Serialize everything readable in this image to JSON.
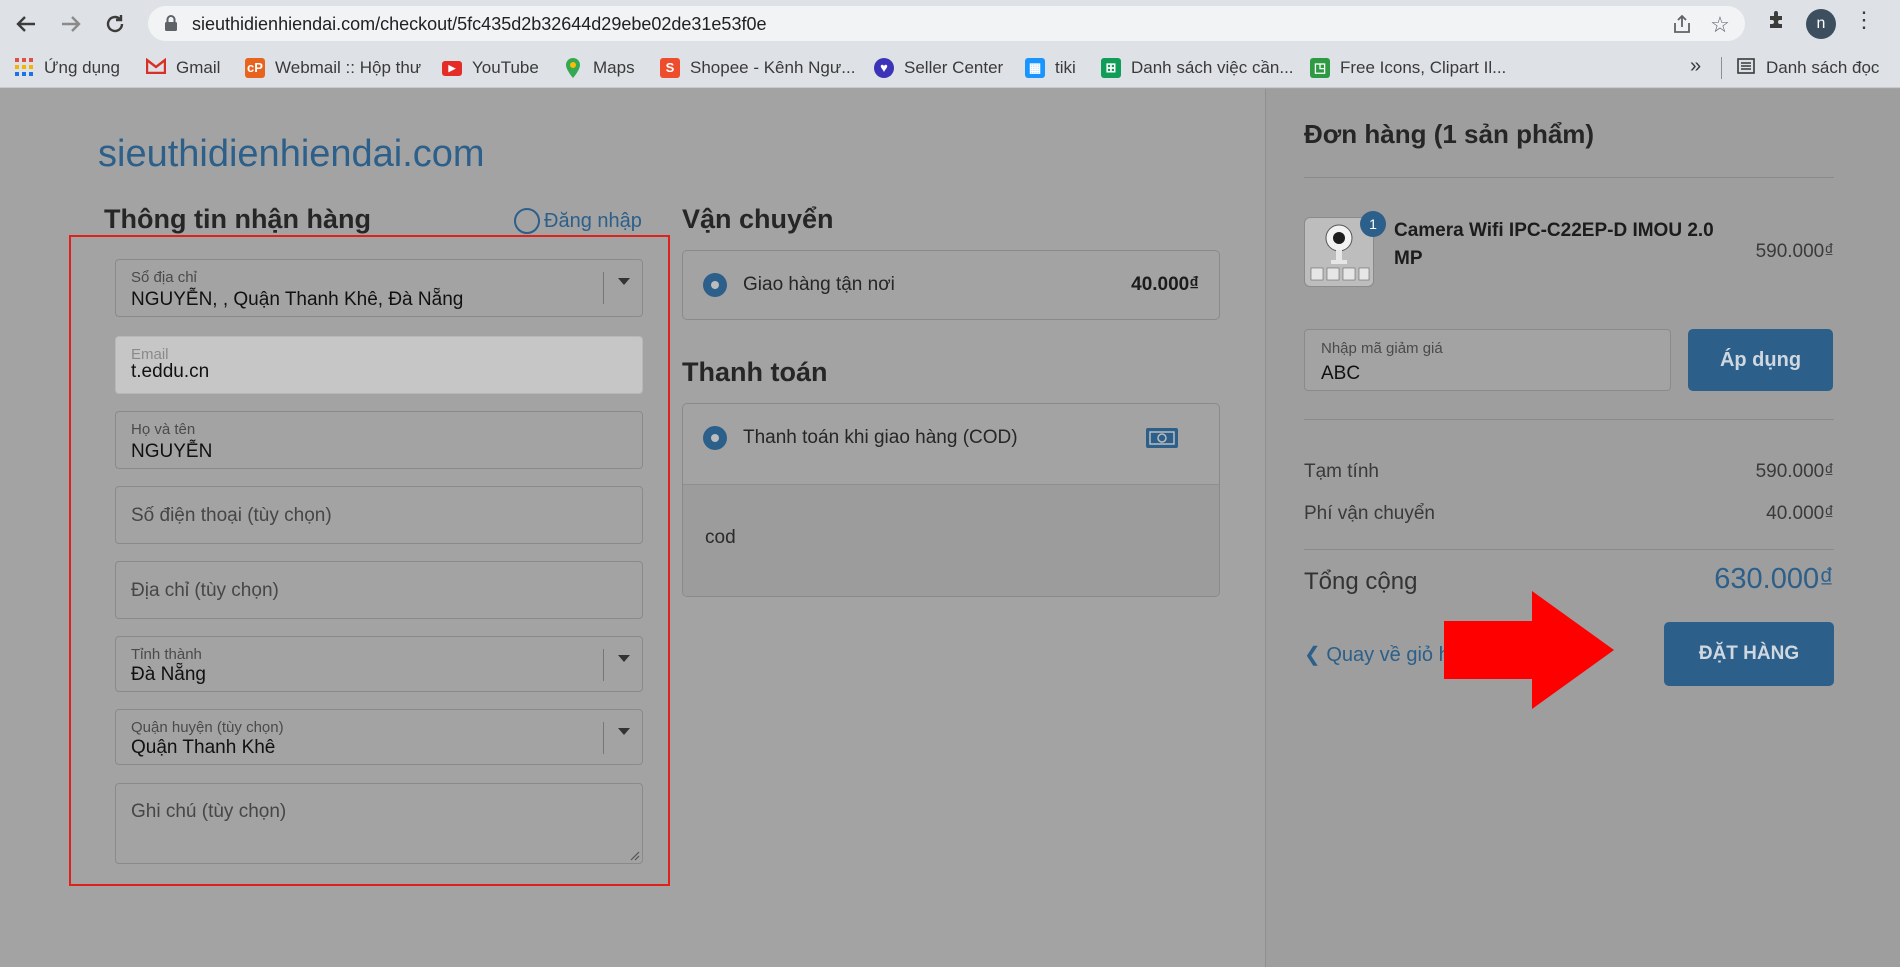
{
  "browser": {
    "url": "sieuthidienhiendai.com/checkout/5fc435d2b32644d29ebe02de31e53f0e",
    "profile_initial": "n"
  },
  "bookmarks": [
    {
      "label": "Ứng dụng",
      "icon": "apps-grid-icon"
    },
    {
      "label": "Gmail",
      "icon": "gmail-icon"
    },
    {
      "label": "Webmail :: Hộp thư",
      "icon": "webmail-icon"
    },
    {
      "label": "YouTube",
      "icon": "youtube-icon"
    },
    {
      "label": "Maps",
      "icon": "maps-icon"
    },
    {
      "label": "Shopee - Kênh Ngư...",
      "icon": "shopee-icon"
    },
    {
      "label": "Seller Center",
      "icon": "seller-center-icon"
    },
    {
      "label": "tiki",
      "icon": "tiki-icon"
    },
    {
      "label": "Danh sách việc cần...",
      "icon": "sheets-icon"
    },
    {
      "label": "Free Icons, Clipart Il...",
      "icon": "freeicons-icon"
    }
  ],
  "bookmarks_more": "»",
  "reading_list": "Danh sách đọc",
  "site": {
    "title": "sieuthidienhiendai.com"
  },
  "shipping_info": {
    "heading": "Thông tin nhận hàng",
    "login_label": "Đăng nhập",
    "address_book": {
      "label": "Sổ địa chỉ",
      "value": "NGUYỄN, , Quận Thanh Khê, Đà Nẵng"
    },
    "email": {
      "label": "Email",
      "value": "t.eddu.cn"
    },
    "fullname": {
      "label": "Họ và tên",
      "value": "NGUYỄN"
    },
    "phone": {
      "placeholder": "Số điện thoại (tùy chọn)"
    },
    "address": {
      "placeholder": "Địa chỉ (tùy chọn)"
    },
    "province": {
      "label": "Tỉnh thành",
      "value": "Đà Nẵng"
    },
    "district": {
      "label": "Quận huyện (tùy chọn)",
      "value": "Quận Thanh Khê"
    },
    "note": {
      "placeholder": "Ghi chú (tùy chọn)"
    }
  },
  "shipping": {
    "heading": "Vận chuyển",
    "option": "Giao hàng tận nơi",
    "price": "40.000₫"
  },
  "payment": {
    "heading": "Thanh toán",
    "option": "Thanh toán khi giao hàng (COD)",
    "detail": "cod"
  },
  "order": {
    "heading": "Đơn hàng (1 sản phẩm)",
    "item": {
      "name": "Camera Wifi IPC-C22EP-D IMOU 2.0 MP",
      "price": "590.000₫",
      "qty": "1"
    },
    "coupon": {
      "label": "Nhập mã giảm giá",
      "value": "ABC"
    },
    "apply_label": "Áp dụng",
    "subtotal": {
      "label": "Tạm tính",
      "value": "590.000₫"
    },
    "shipping_fee": {
      "label": "Phí vận chuyển",
      "value": "40.000₫"
    },
    "total": {
      "label": "Tổng cộng",
      "value": "630.000₫"
    },
    "back_label": "❮ Quay về giỏ hàng",
    "place_order_label": "ĐẶT HÀNG"
  },
  "colors": {
    "accent": "#2c5f89",
    "highlight_border": "#e0201a",
    "arrow": "#ff0000"
  }
}
